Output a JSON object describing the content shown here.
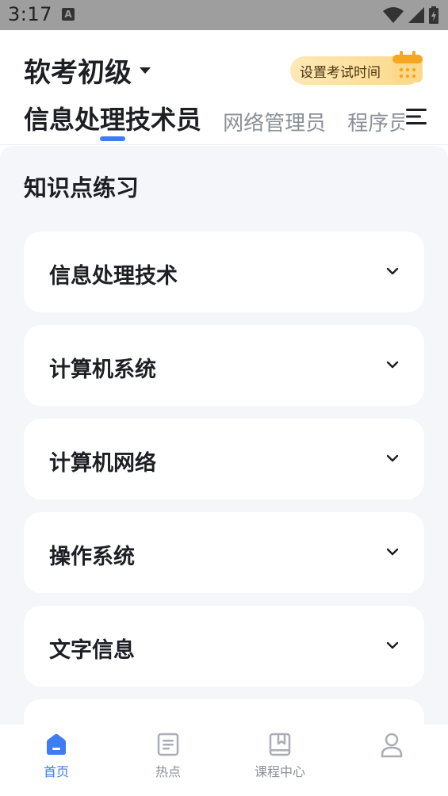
{
  "status_bar": {
    "time": "3:17",
    "notification_icon": "A"
  },
  "header": {
    "exam_level": "软考初级",
    "set_exam_time_label": "设置考试时间",
    "tabs": [
      {
        "label": "信息处理技术员",
        "active": true
      },
      {
        "label": "网络管理员",
        "active": false
      },
      {
        "label": "程序员",
        "active": false
      }
    ]
  },
  "section": {
    "title": "知识点练习",
    "items": [
      {
        "label": "信息处理技术"
      },
      {
        "label": "计算机系统"
      },
      {
        "label": "计算机网络"
      },
      {
        "label": "操作系统"
      },
      {
        "label": "文字信息"
      }
    ]
  },
  "tabbar": {
    "items": [
      {
        "label": "首页",
        "icon": "home-icon",
        "active": true
      },
      {
        "label": "热点",
        "icon": "document-icon",
        "active": false
      },
      {
        "label": "课程中心",
        "icon": "book-icon",
        "active": false
      },
      {
        "label": "",
        "icon": "user-icon",
        "active": false
      }
    ]
  },
  "colors": {
    "accent": "#3d7cf2",
    "badge": "#fbd98a",
    "background": "#f5f6fa"
  }
}
